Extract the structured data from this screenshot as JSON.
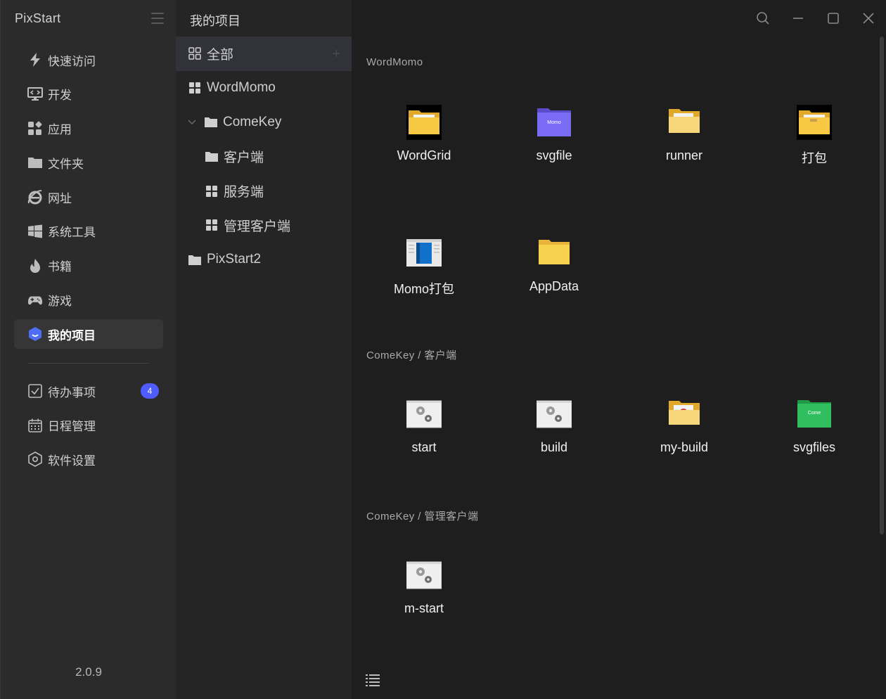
{
  "app": {
    "title": "PixStart",
    "version": "2.0.9"
  },
  "sidebar": {
    "items": [
      {
        "label": "快速访问",
        "icon": "lightning-icon"
      },
      {
        "label": "开发",
        "icon": "monitor-code-icon"
      },
      {
        "label": "应用",
        "icon": "apps-grid-icon"
      },
      {
        "label": "文件夹",
        "icon": "folder-icon"
      },
      {
        "label": "网址",
        "icon": "browser-e-icon"
      },
      {
        "label": "系统工具",
        "icon": "windows-icon"
      },
      {
        "label": "书籍",
        "icon": "flame-icon"
      },
      {
        "label": "游戏",
        "icon": "gamepad-icon"
      },
      {
        "label": "我的项目",
        "icon": "project-icon",
        "active": true
      }
    ],
    "bottom_items": [
      {
        "label": "待办事项",
        "icon": "checkbox-icon",
        "badge": "4"
      },
      {
        "label": "日程管理",
        "icon": "calendar-icon"
      },
      {
        "label": "软件设置",
        "icon": "settings-hex-icon"
      }
    ]
  },
  "middle": {
    "title": "我的项目",
    "tree": [
      {
        "label": "全部",
        "icon": "grid-outline-icon",
        "selected": true
      },
      {
        "label": "WordMomo",
        "icon": "grid-filled-icon"
      },
      {
        "label": "ComeKey",
        "icon": "folder-icon",
        "expanded": true
      },
      {
        "label": "客户端",
        "icon": "folder-icon"
      },
      {
        "label": "服务端",
        "icon": "grid-filled-icon"
      },
      {
        "label": "管理客户端",
        "icon": "grid-filled-icon"
      },
      {
        "label": "PixStart2",
        "icon": "folder-icon"
      }
    ]
  },
  "main": {
    "groups": [
      {
        "title": "WordMomo",
        "items": [
          {
            "label": "WordGrid",
            "icon": "folder-dark-icon"
          },
          {
            "label": "svgfile",
            "icon": "folder-purple-icon",
            "tag": "Momo"
          },
          {
            "label": "runner",
            "icon": "folder-yellow-icon"
          },
          {
            "label": "打包",
            "icon": "folder-dark-icon"
          },
          {
            "label": "Momo打包",
            "icon": "book-app-icon"
          },
          {
            "label": "AppData",
            "icon": "folder-plain-icon"
          }
        ]
      },
      {
        "title": "ComeKey / 客户端",
        "items": [
          {
            "label": "start",
            "icon": "gears-script-icon"
          },
          {
            "label": "build",
            "icon": "gears-script-icon"
          },
          {
            "label": "my-build",
            "icon": "folder-yellow-icon"
          },
          {
            "label": "svgfiles",
            "icon": "folder-green-icon",
            "tag": "Come"
          }
        ]
      },
      {
        "title": "ComeKey / 管理客户端",
        "items": [
          {
            "label": "m-start",
            "icon": "gears-script-icon"
          }
        ]
      }
    ]
  },
  "colors": {
    "accent": "#4f5cff",
    "folder_yellow": "#f7c844",
    "folder_purple": "#7b6cf6",
    "folder_green": "#2fbf5f"
  }
}
